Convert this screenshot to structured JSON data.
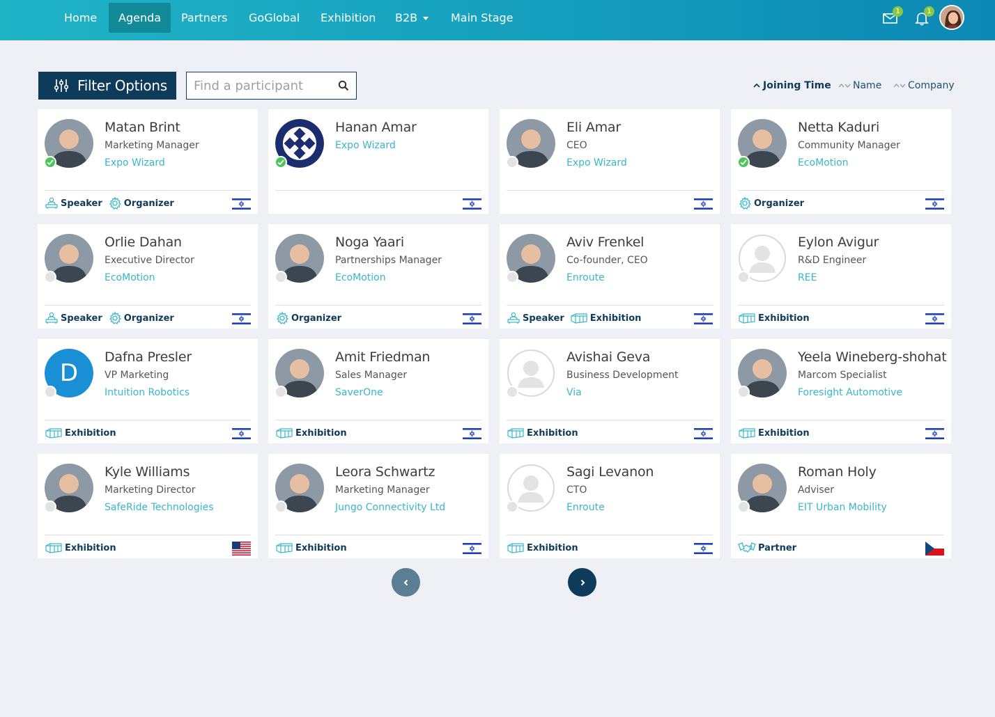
{
  "nav": {
    "items": [
      {
        "label": "Home"
      },
      {
        "label": "Agenda"
      },
      {
        "label": "Partners"
      },
      {
        "label": "GoGlobal"
      },
      {
        "label": "Exhibition"
      },
      {
        "label": "B2B"
      },
      {
        "label": "Main Stage"
      }
    ],
    "active": "Agenda",
    "messages_badge": "1",
    "notifications_badge": "1",
    "icons": [
      "envelope-icon",
      "bell-icon",
      "user-avatar"
    ]
  },
  "toolbar": {
    "filter_label": "Filter Options",
    "search_placeholder": "Find a participant",
    "sort": {
      "joining_time": "Joining Time",
      "name": "Name",
      "company": "Company",
      "active": "Joining Time"
    }
  },
  "colors": {
    "primary_dark": "#0f3b5a",
    "accent": "#38b6cc",
    "online": "#4cc65a",
    "nav_gradient_start": "#1fb3c6",
    "nav_gradient_end": "#0c88b4"
  },
  "participants": [
    {
      "name": "Matan Brint",
      "title": "Marketing Manager",
      "company": "Expo Wizard",
      "online": true,
      "tags": [
        "Speaker",
        "Organizer"
      ],
      "flag": "israel",
      "avatar": "photo"
    },
    {
      "name": "Hanan Amar",
      "title": "",
      "company": "Expo Wizard",
      "online": true,
      "tags": [],
      "flag": "israel",
      "avatar": "logo"
    },
    {
      "name": "Eli Amar",
      "title": "CEO",
      "company": "Expo Wizard",
      "online": false,
      "tags": [],
      "flag": "israel",
      "avatar": "photo"
    },
    {
      "name": "Netta Kaduri",
      "title": "Community Manager",
      "company": "EcoMotion",
      "online": true,
      "tags": [
        "Organizer"
      ],
      "flag": "israel",
      "avatar": "photo"
    },
    {
      "name": "Orlie Dahan",
      "title": "Executive Director",
      "company": "EcoMotion",
      "online": false,
      "tags": [
        "Speaker",
        "Organizer"
      ],
      "flag": "israel",
      "avatar": "photo"
    },
    {
      "name": "Noga Yaari",
      "title": "Partnerships Manager",
      "company": "EcoMotion",
      "online": false,
      "tags": [
        "Organizer"
      ],
      "flag": "israel",
      "avatar": "photo"
    },
    {
      "name": "Aviv Frenkel",
      "title": "Co-founder, CEO",
      "company": "Enroute",
      "online": false,
      "tags": [
        "Speaker",
        "Exhibition"
      ],
      "flag": "israel",
      "avatar": "photo"
    },
    {
      "name": "Eylon Avigur",
      "title": "R&D Engineer",
      "company": "REE",
      "online": false,
      "tags": [
        "Exhibition"
      ],
      "flag": "israel",
      "avatar": "placeholder"
    },
    {
      "name": "Dafna Presler",
      "title": "VP Marketing",
      "company": "Intuition Robotics",
      "online": false,
      "tags": [
        "Exhibition"
      ],
      "flag": "israel",
      "avatar": "initial",
      "initial": "D"
    },
    {
      "name": "Amit Friedman",
      "title": "Sales Manager",
      "company": "SaverOne",
      "online": false,
      "tags": [
        "Exhibition"
      ],
      "flag": "israel",
      "avatar": "photo"
    },
    {
      "name": "Avishai Geva",
      "title": "Business Development",
      "company": "Via",
      "online": false,
      "tags": [
        "Exhibition"
      ],
      "flag": "israel",
      "avatar": "placeholder"
    },
    {
      "name": "Yeela Wineberg-shohat",
      "title": "Marcom Specialist",
      "company": "Foresight Automotive",
      "online": false,
      "tags": [
        "Exhibition"
      ],
      "flag": "israel",
      "avatar": "photo"
    },
    {
      "name": "Kyle Williams",
      "title": "Marketing Director",
      "company": "SafeRide Technologies",
      "online": false,
      "tags": [
        "Exhibition"
      ],
      "flag": "usa",
      "avatar": "photo"
    },
    {
      "name": "Leora Schwartz",
      "title": "Marketing Manager",
      "company": "Jungo Connectivity Ltd",
      "online": false,
      "tags": [
        "Exhibition"
      ],
      "flag": "israel",
      "avatar": "photo"
    },
    {
      "name": "Sagi Levanon",
      "title": "CTO",
      "company": "Enroute",
      "online": false,
      "tags": [
        "Exhibition"
      ],
      "flag": "israel",
      "avatar": "placeholder"
    },
    {
      "name": "Roman Holy",
      "title": "Adviser",
      "company": "EIT Urban Mobility",
      "online": false,
      "tags": [
        "Partner"
      ],
      "flag": "czech",
      "avatar": "photo"
    }
  ],
  "pagination": {
    "prev_icon": "chevron-left-icon",
    "next_icon": "chevron-right-icon"
  }
}
